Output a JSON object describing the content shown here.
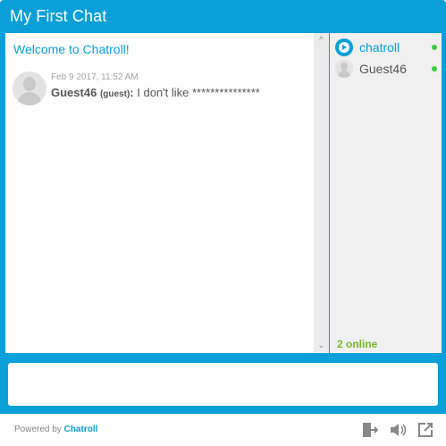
{
  "header": {
    "title": "My First Chat"
  },
  "chat": {
    "welcome": "Welcome to Chatroll!",
    "messages": [
      {
        "timestamp": "Feb 9 2017, 11:52 AM",
        "author": "Guest46",
        "tag": "(guest)",
        "separator": ":",
        "text": " I don't like ***************"
      }
    ]
  },
  "users": {
    "list": [
      {
        "name": "chatroll",
        "color": "#0a9fd8",
        "icon": "chatroll-logo-icon"
      },
      {
        "name": "Guest46",
        "color": "#555555",
        "icon": "guest-avatar-icon"
      }
    ],
    "online_label": "2 online"
  },
  "input": {
    "placeholder": ""
  },
  "footer": {
    "powered_prefix": "Powered by ",
    "powered_brand": "Chatroll",
    "icons": [
      "exit-door-icon",
      "speaker-icon",
      "popout-icon"
    ]
  },
  "colors": {
    "accent": "#0a9fd8",
    "online": "#3ec83e",
    "online_text": "#7ab52c"
  }
}
